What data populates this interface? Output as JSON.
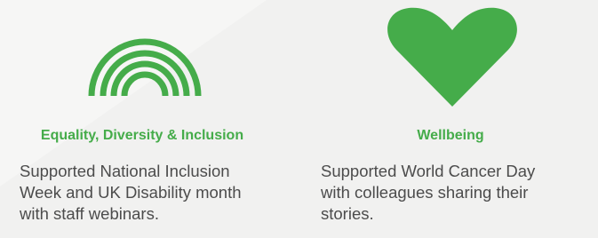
{
  "colors": {
    "accent": "#45ac4a",
    "text": "#4c4c4c",
    "background": "#f1f1f0"
  },
  "cards": [
    {
      "icon": "rainbow-icon",
      "title": "Equality, Diversity & Inclusion",
      "description_lines": [
        "Supported National Inclusion",
        "Week and UK Disability month",
        "with staff webinars."
      ]
    },
    {
      "icon": "heart-icon",
      "title": "Wellbeing",
      "description_lines": [
        "Supported World Cancer Day",
        "with colleagues sharing their",
        "stories."
      ]
    }
  ]
}
